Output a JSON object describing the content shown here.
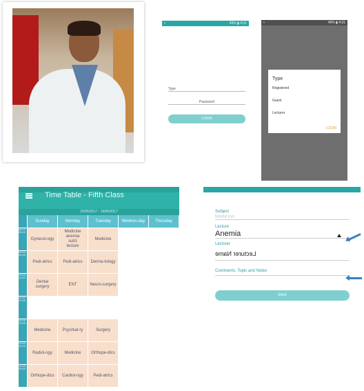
{
  "phone_login": {
    "status": "▪",
    "status_right": "49% ▮ 4:31",
    "field1": "Type",
    "field2": "Password",
    "button": "LOGIN"
  },
  "phone_dialog": {
    "status": "▪",
    "status_right": "49% ▮ 4:31",
    "title": "Type",
    "options": [
      "Registered",
      "Guest",
      "Lecturer"
    ],
    "action": "LOGIN"
  },
  "timetable": {
    "status": "",
    "status_right": "",
    "title": "Time Table - Fifth Class",
    "dateband": "15/05/2017 - 19/05/2017",
    "days": [
      "Sunday",
      "Monday",
      "Tuesday",
      "Wednes-day",
      "Thursday"
    ],
    "times": [
      "08:00 09:00",
      "09:00 10:00",
      "10:00 11:00",
      "11:00 12:00",
      "12:00 13:00",
      "13:00 14:00",
      "14:00 15:00"
    ],
    "rows": [
      [
        "Gynecol-ogy",
        "Medicine\nanemia\nsub1\nlecture",
        "Medicine",
        "",
        ""
      ],
      [
        "Pedi-atrics",
        "Pedi-atrics",
        "Derma-tology",
        "",
        ""
      ],
      [
        "Dental\nsurgery",
        "ENT",
        "Neuro-surgery",
        "",
        ""
      ],
      [
        "",
        "",
        "",
        "",
        ""
      ],
      [
        "Medicine",
        "Psychiat-ry",
        "Surgery",
        "",
        ""
      ],
      [
        "Radiol-ogy",
        "Medicine",
        "Orthope-dics",
        "",
        ""
      ],
      [
        "Orthope-dics",
        "Cardiol-ogy",
        "Pedi-atrics",
        "",
        ""
      ]
    ]
  },
  "form": {
    "status": "",
    "status_right": "",
    "subject_label": "Subject",
    "subject_value": "Medicine",
    "lecture_label": "Lecture",
    "lecture_value": "Anemia",
    "lecturer_label": "Lecturer",
    "lecturer_value": "Lecturer Name",
    "comments_label": "Comments, Topic and Notes",
    "button": "SAVE"
  }
}
